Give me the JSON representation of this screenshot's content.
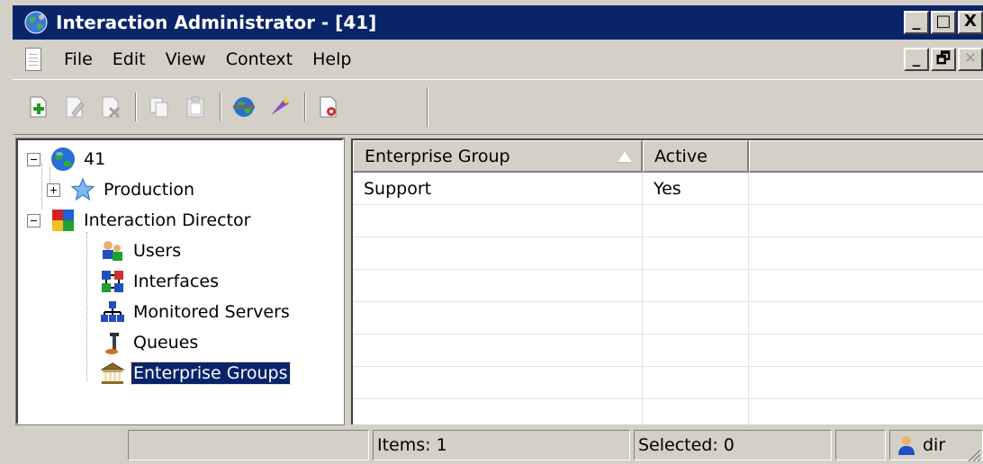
{
  "window": {
    "title": "Interaction Administrator - [41]",
    "controls": [
      "_",
      "□",
      "X"
    ]
  },
  "menu": {
    "items": [
      "File",
      "Edit",
      "View",
      "Context",
      "Help"
    ],
    "mdi_controls": [
      "_",
      "🗗",
      "✕"
    ]
  },
  "toolbar": {
    "buttons": [
      "add-icon",
      "edit-icon",
      "delete-icon",
      "copy-icon",
      "paste-icon",
      "connect-icon",
      "wizard-icon",
      "properties-icon"
    ]
  },
  "tree": {
    "nodes": [
      {
        "label": "41",
        "icon": "globe-icon",
        "level": 0,
        "expander": "minus"
      },
      {
        "label": "Production",
        "icon": "star-icon",
        "level": 1,
        "expander": "plus"
      },
      {
        "label": "Interaction Director",
        "icon": "puzzle-icon",
        "level": 0,
        "expander": "minus"
      },
      {
        "label": "Users",
        "icon": "users-icon",
        "level": 1
      },
      {
        "label": "Interfaces",
        "icon": "interfaces-icon",
        "level": 1
      },
      {
        "label": "Monitored Servers",
        "icon": "servers-icon",
        "level": 1
      },
      {
        "label": "Queues",
        "icon": "queue-icon",
        "level": 1
      },
      {
        "label": "Enterprise Groups",
        "icon": "building-icon",
        "level": 1,
        "selected": true
      }
    ]
  },
  "list": {
    "columns": [
      "Enterprise Group",
      "Active",
      ""
    ],
    "rows": [
      [
        "Support",
        "Yes",
        ""
      ]
    ],
    "sorted_column": "Enterprise Group"
  },
  "status": {
    "items": "Items: 1",
    "selected": "Selected: 0",
    "user": "dir"
  },
  "colors": {
    "titlebar": "#0a246a",
    "selection": "#0a246a",
    "face": "#d4d0c8"
  }
}
